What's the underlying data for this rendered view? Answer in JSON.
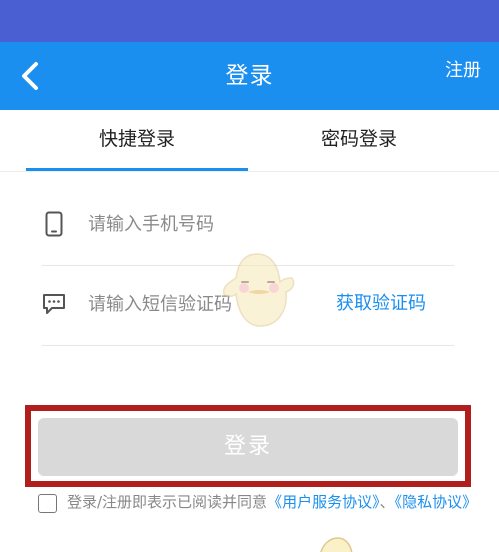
{
  "colors": {
    "status_bar": "#4a5fd2",
    "nav_bar": "#1a8ff0",
    "accent": "#1a8ff0",
    "button_disabled": "#d9d9d9",
    "highlight_border": "#b01e1e"
  },
  "nav": {
    "back_icon": "chevron-left-icon",
    "title": "登录",
    "register_label": "注册"
  },
  "tabs": [
    {
      "label": "快捷登录",
      "active": true
    },
    {
      "label": "密码登录",
      "active": false
    }
  ],
  "form": {
    "phone": {
      "icon": "phone-icon",
      "placeholder": "请输入手机号码",
      "value": ""
    },
    "sms": {
      "icon": "message-icon",
      "placeholder": "请输入短信验证码",
      "value": ""
    },
    "get_code_label": "获取验证码"
  },
  "login_button": {
    "label": "登录",
    "enabled": false
  },
  "agreement": {
    "checked": false,
    "text": "登录/注册即表示已阅读并同意",
    "user_agreement": "《用户服务协议》",
    "separator": "、",
    "privacy_policy": "《隐私协议》"
  }
}
